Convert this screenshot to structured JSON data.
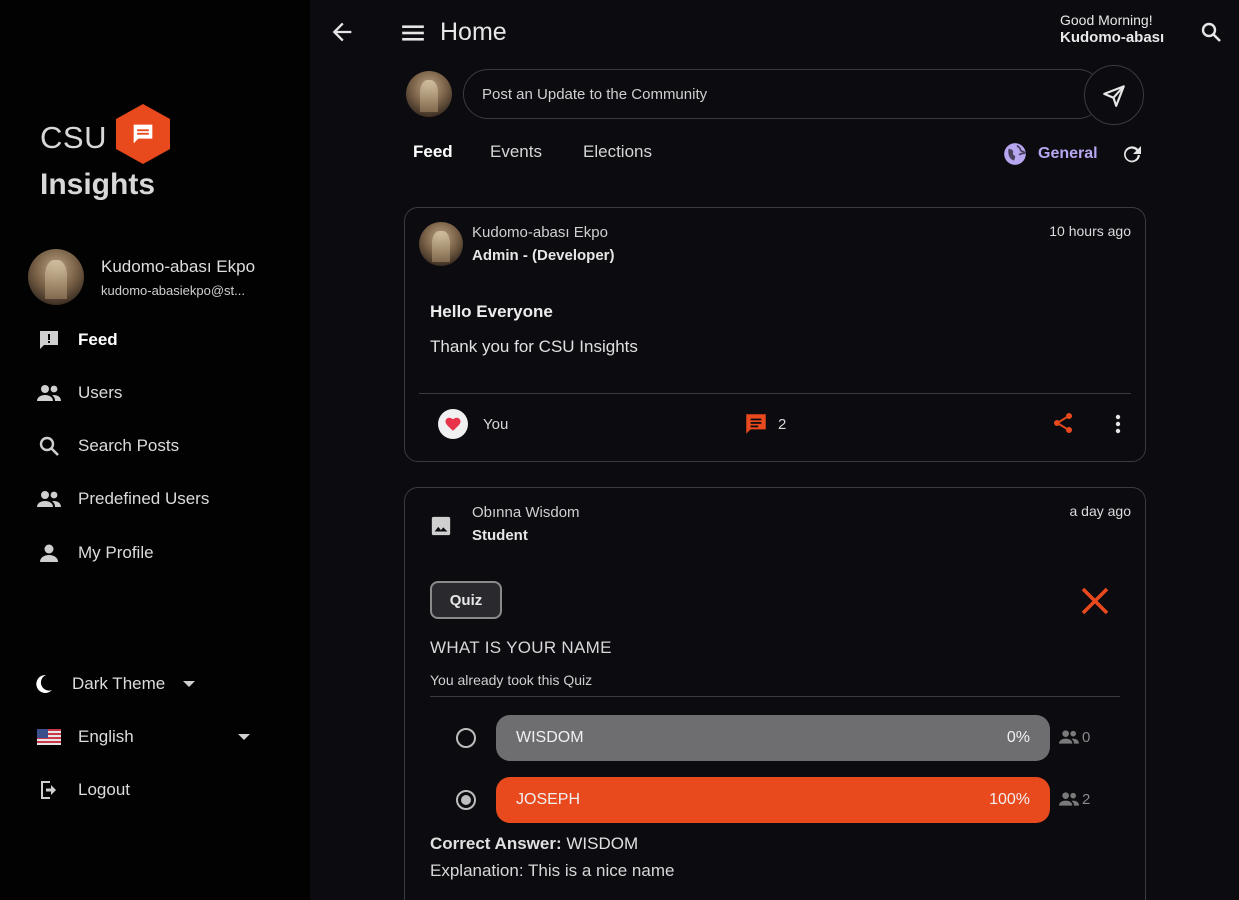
{
  "app": {
    "logo_top": "CSU",
    "logo_bottom": "Insights"
  },
  "user": {
    "name": "Kudomo-abası Ekpo",
    "email": "kudomo-abasiekpo@st..."
  },
  "sidebar": {
    "items": [
      {
        "label": "Feed",
        "icon": "feed-icon"
      },
      {
        "label": "Users",
        "icon": "users-icon"
      },
      {
        "label": "Search Posts",
        "icon": "search-icon"
      },
      {
        "label": "Predefined Users",
        "icon": "users-icon"
      },
      {
        "label": "My Profile",
        "icon": "person-icon"
      }
    ],
    "theme": "Dark Theme",
    "language": "English",
    "logout": "Logout"
  },
  "header": {
    "title": "Home",
    "greeting": "Good Morning!",
    "greeting_name": "Kudomo-abası"
  },
  "composer": {
    "placeholder": "Post an Update to the Community"
  },
  "tabs": {
    "feed": "Feed",
    "events": "Events",
    "elections": "Elections",
    "filter": "General"
  },
  "posts": [
    {
      "author": "Kudomo-abası Ekpo",
      "role": "Admin - (Developer)",
      "time": "10 hours ago",
      "heading": "Hello Everyone",
      "body": "Thank you for CSU Insights",
      "likes_label": "You",
      "comments": "2"
    },
    {
      "author": "Obınna Wisdom",
      "role": "Student",
      "time": "a day ago",
      "badge": "Quiz",
      "question": "WHAT IS YOUR NAME",
      "note": "You already took this Quiz",
      "options": [
        {
          "label": "WISDOM",
          "percent": "0%",
          "votes": "0",
          "fraction": 0,
          "selected": false
        },
        {
          "label": "JOSEPH",
          "percent": "100%",
          "votes": "2",
          "fraction": 1,
          "selected": true
        }
      ],
      "correct_label": "Correct Answer:",
      "correct_value": "WISDOM",
      "explanation": "Explanation: This is a nice name"
    }
  ],
  "colors": {
    "accent": "#e8491d",
    "background": "#0b0b10",
    "sidebar": "#020203",
    "filter": "#b8a6f0",
    "option_neutral": "#6e6e70"
  }
}
